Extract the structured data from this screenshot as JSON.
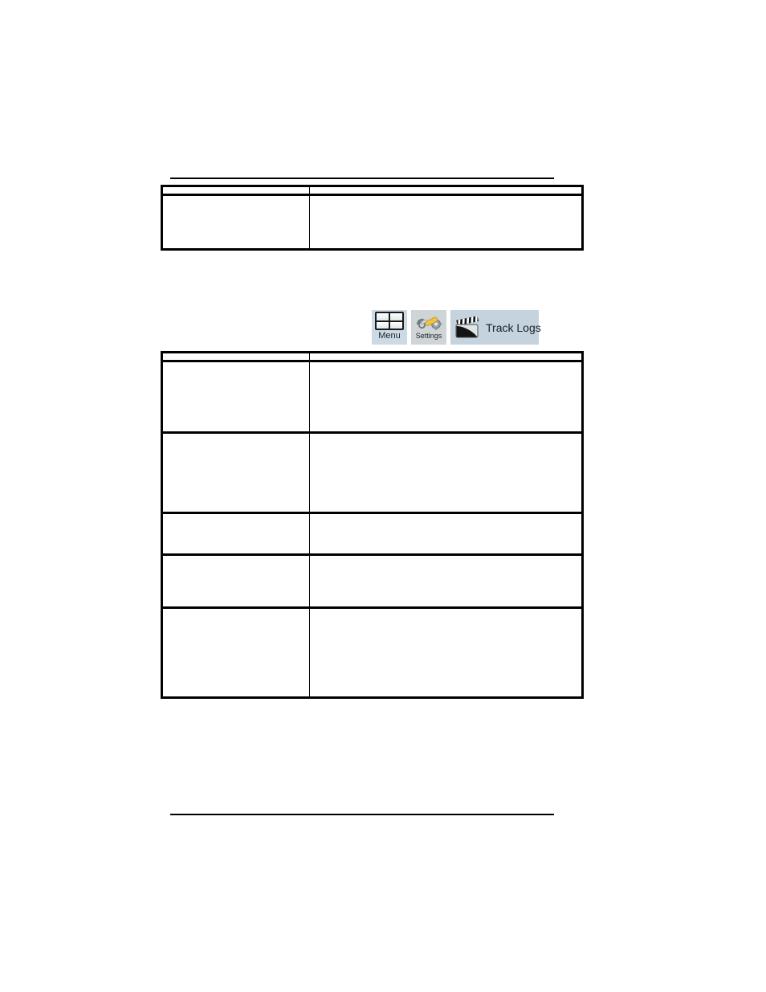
{
  "document": {
    "page_background": "#ffffff",
    "rule_color": "#000000",
    "top_rule": {
      "label": ""
    },
    "footer_rule": {
      "label": ""
    }
  },
  "table_one": {
    "columns": [
      "",
      ""
    ],
    "rows": [
      {
        "cells": [
          "",
          ""
        ]
      },
      {
        "cells": [
          "",
          ""
        ]
      }
    ]
  },
  "table_two": {
    "columns": [
      "",
      ""
    ],
    "rows": [
      {
        "cells": [
          "",
          ""
        ]
      },
      {
        "cells": [
          "",
          ""
        ]
      },
      {
        "cells": [
          "",
          ""
        ]
      },
      {
        "cells": [
          "",
          ""
        ]
      },
      {
        "cells": [
          "",
          ""
        ]
      },
      {
        "cells": [
          "",
          ""
        ]
      }
    ]
  },
  "toolbar": {
    "buttons": [
      {
        "id": "menu",
        "label": "Menu",
        "icon": "grid-menu-icon",
        "background": "#ccdae6"
      },
      {
        "id": "settings",
        "label": "Settings",
        "icon": "screwdriver-gears-icon",
        "background": "#cfd4d6"
      },
      {
        "id": "track-logs",
        "label": "Track Logs",
        "icon": "clapperboard-icon",
        "background": "#c4d3dd"
      }
    ]
  },
  "colors": {
    "menu_button_bg": "#ccdae6",
    "settings_button_bg": "#cfd4d6",
    "track_logs_button_bg": "#c4d3dd",
    "screwdriver_yellow": "#f2c33c",
    "gear_gray": "#8d949a",
    "clapper_black": "#141414",
    "text_dark": "#16202a",
    "border_black": "#000000"
  }
}
